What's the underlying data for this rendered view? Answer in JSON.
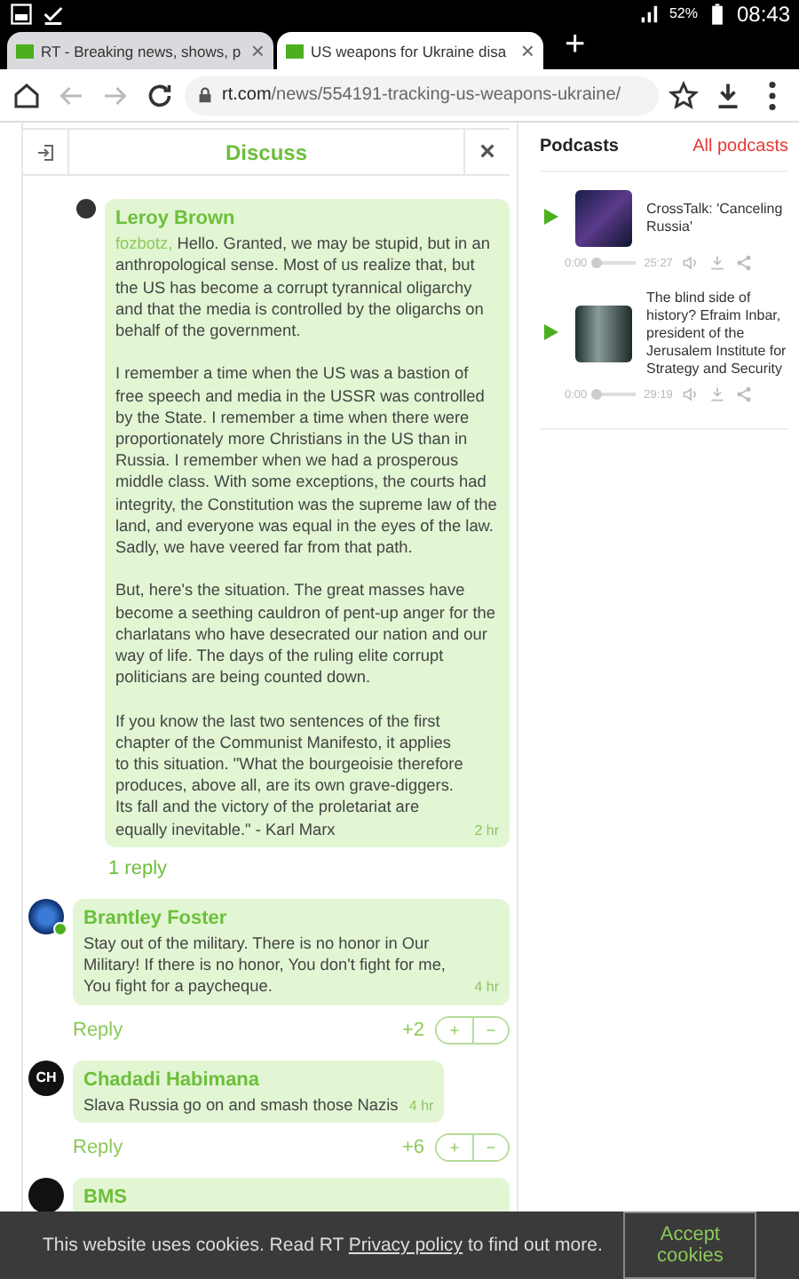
{
  "status_bar": {
    "battery": "52%",
    "time": "08:43"
  },
  "browser_tabs": [
    {
      "title": "RT - Breaking news, shows, p",
      "selected": false,
      "close": "×"
    },
    {
      "title": "US weapons for Ukraine disa",
      "selected": true,
      "close": "×"
    }
  ],
  "new_tab": "+",
  "address_bar": {
    "domain": "rt.com",
    "path": "/news/554191-tracking-us-weapons-ukraine/"
  },
  "discuss_panel": {
    "title": "Discuss",
    "close": "×",
    "comments": [
      {
        "kind": "reply",
        "author": "Leroy Brown",
        "mention": "fozbotz,",
        "paragraphs": [
          "Hello. Granted, we may be stupid, but in an anthropological sense. Most of us realize that, but the US has become a corrupt tyrannical oligarchy and that the media is controlled by the oligarchs on behalf of the government.",
          "I remember a time when the US was a bastion of free speech and media in the USSR was controlled by the State. I remember a time when there were proportionately more Christians in the US than in Russia. I remember when we had a prosperous middle class. With some exceptions, the courts had integrity, the Constitution was the supreme law of the land, and everyone was equal in the eyes of the law. Sadly, we have veered far from that path.",
          "But, here's the situation. The great masses have become a seething cauldron of pent-up anger for the charlatans who have desecrated our nation and our way of life. The days of the ruling elite corrupt politicians are being counted down.",
          "If you know the last two sentences of the first chapter of the Communist Manifesto, it applies to this situation. \"What the bourgeoisie therefore produces, above all, are its own grave-diggers. Its fall and the victory of the proletariat are equally inevitable.\" - Karl Marx"
        ],
        "time": "2 hr",
        "replies": "1 reply"
      },
      {
        "kind": "top",
        "author": "Brantley Foster",
        "online": true,
        "paragraphs": [
          "Stay out of the military. There is no honor in Our Military! If there is no honor, You don't fight for me, You fight for a paycheque."
        ],
        "time": "4 hr",
        "reply": "Reply",
        "score": "+2",
        "up": "+",
        "down": "−"
      },
      {
        "kind": "top",
        "author": "Chadadi Habimana",
        "avatar_text": "CH",
        "paragraphs": [
          "Slava Russia go on and smash those Nazis"
        ],
        "time": "4 hr",
        "reply": "Reply",
        "score": "+6",
        "up": "+",
        "down": "−"
      },
      {
        "kind": "top",
        "author": "BMS"
      }
    ]
  },
  "podcasts": {
    "title": "Podcasts",
    "link": "All podcasts",
    "items": [
      {
        "title": "CrossTalk: 'Canceling Russia'",
        "start": "0:00",
        "duration": "25:27",
        "level": 0
      },
      {
        "title": "The blind side of history? Efraim Inbar, president of the Jerusalem Institute for Strategy and Security",
        "start": "0:00",
        "duration": "29:19",
        "level": 0
      }
    ]
  },
  "cookie_bar": {
    "before": "This website uses cookies. Read RT",
    "link": "Privacy policy",
    "after": "to find out more.",
    "button": "Accept cookies"
  }
}
